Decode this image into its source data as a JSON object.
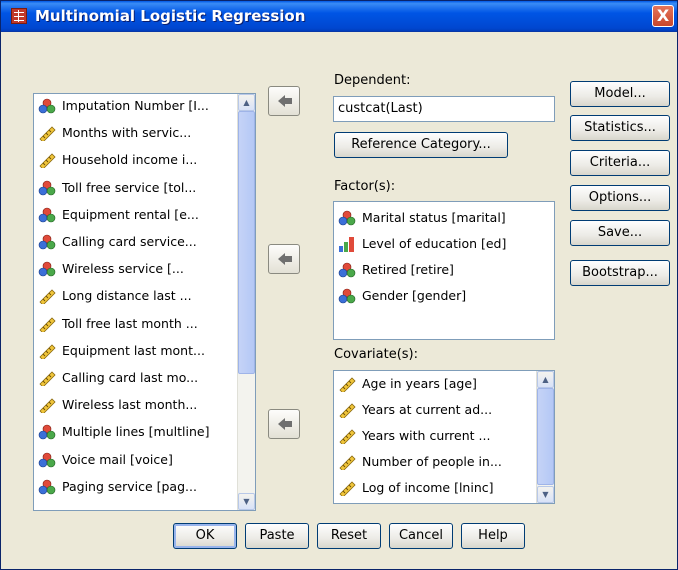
{
  "window": {
    "title": "Multinomial Logistic Regression",
    "close_label": "X"
  },
  "variables": [
    {
      "label": "Imputation Number [I...",
      "icon": "nominal-icon"
    },
    {
      "label": "Months with servic...",
      "icon": "scale-ruler-icon"
    },
    {
      "label": "Household income i...",
      "icon": "scale-ruler-icon"
    },
    {
      "label": "Toll free service [tol...",
      "icon": "nominal-icon"
    },
    {
      "label": "Equipment rental [e...",
      "icon": "nominal-icon"
    },
    {
      "label": "Calling card service...",
      "icon": "nominal-icon"
    },
    {
      "label": "Wireless service [...",
      "icon": "nominal-icon"
    },
    {
      "label": "Long distance last ...",
      "icon": "scale-ruler-icon"
    },
    {
      "label": "Toll free last month ...",
      "icon": "scale-ruler-icon"
    },
    {
      "label": "Equipment last mont...",
      "icon": "scale-ruler-icon"
    },
    {
      "label": "Calling card last mo...",
      "icon": "scale-ruler-icon"
    },
    {
      "label": "Wireless last month...",
      "icon": "scale-ruler-icon"
    },
    {
      "label": "Multiple lines [multline]",
      "icon": "nominal-icon"
    },
    {
      "label": "Voice mail [voice]",
      "icon": "nominal-icon"
    },
    {
      "label": "Paging service [pag...",
      "icon": "nominal-icon"
    }
  ],
  "dependent": {
    "label": "Dependent:",
    "value": "custcat(Last)",
    "reference_button": "Reference Category..."
  },
  "factors": {
    "label": "Factor(s):",
    "items": [
      {
        "label": "Marital status [marital]",
        "icon": "nominal-icon"
      },
      {
        "label": "Level of education [ed]",
        "icon": "ordinal-bar-icon"
      },
      {
        "label": "Retired [retire]",
        "icon": "nominal-icon"
      },
      {
        "label": "Gender [gender]",
        "icon": "nominal-icon"
      }
    ]
  },
  "covariates": {
    "label": "Covariate(s):",
    "items": [
      {
        "label": "Age in years [age]",
        "icon": "scale-ruler-icon"
      },
      {
        "label": "Years at current ad...",
        "icon": "scale-ruler-icon"
      },
      {
        "label": "Years with current ...",
        "icon": "scale-ruler-icon"
      },
      {
        "label": "Number of people in...",
        "icon": "scale-ruler-icon"
      },
      {
        "label": "Log of income  [lninc]",
        "icon": "scale-ruler-icon"
      }
    ]
  },
  "side_buttons": {
    "model": "Model...",
    "statistics": "Statistics...",
    "criteria": "Criteria...",
    "options": "Options...",
    "save": "Save...",
    "bootstrap": "Bootstrap..."
  },
  "bottom_buttons": {
    "ok": "OK",
    "paste": "Paste",
    "reset": "Reset",
    "cancel": "Cancel",
    "help": "Help"
  },
  "colors": {
    "title_bar": "#0055e5",
    "dialog_bg": "#ece9d8",
    "border_blue": "#7f9db9",
    "close_red": "#c8472d"
  }
}
